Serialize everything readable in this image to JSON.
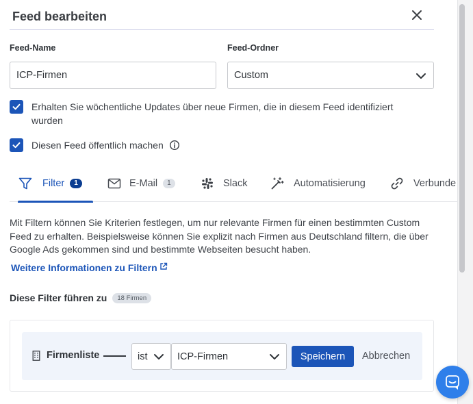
{
  "dialog": {
    "title": "Feed bearbeiten"
  },
  "form": {
    "feed_name_label": "Feed-Name",
    "feed_name_value": "ICP-Firmen",
    "feed_folder_label": "Feed-Ordner",
    "feed_folder_value": "Custom",
    "weekly_updates_text": "Erhalten Sie wöchentliche Updates über neue Firmen, die in diesem Feed identifiziert wurden",
    "weekly_updates_checked": true,
    "public_text": "Diesen Feed öffentlich machen",
    "public_checked": true
  },
  "tabs": [
    {
      "label": "Filter",
      "badge": "1",
      "active": true,
      "icon": "filter-icon"
    },
    {
      "label": "E-Mail",
      "badge": "1",
      "active": false,
      "icon": "mail-icon"
    },
    {
      "label": "Slack",
      "badge": "",
      "active": false,
      "icon": "slack-icon"
    },
    {
      "label": "Automatisierung",
      "badge": "",
      "active": false,
      "icon": "magic-wand-icon"
    },
    {
      "label": "Verbunde",
      "badge": "",
      "active": false,
      "icon": "link-icon"
    }
  ],
  "filter_section": {
    "description": "Mit Filtern können Sie Kriterien festlegen, um nur relevante Firmen für einen bestimmten Custom Feed zu erhalten. Beispielsweise können Sie explizit nach Firmen aus Deutschland filtern, die über Google Ads gekommen sind und bestimmte Webseiten besucht haben.",
    "more_link": "Weitere Informationen zu Filtern",
    "result_label": "Diese Filter führen zu",
    "result_badge": "18 Firmen"
  },
  "filter_row": {
    "field_name": "Firmenliste",
    "operator": "ist",
    "value": "ICP-Firmen",
    "save_label": "Speichern",
    "cancel_label": "Abbrechen"
  },
  "colors": {
    "accent": "#1c55b8",
    "badge_dark": "#0b3d91",
    "chat_button": "#2f7fea"
  }
}
